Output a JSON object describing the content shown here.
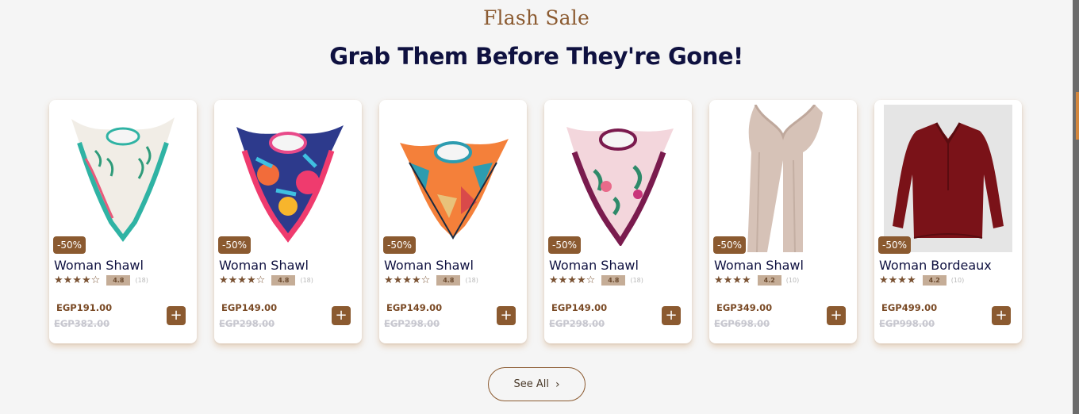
{
  "section": {
    "eyebrow": "Flash Sale",
    "title": "Grab Them Before They're Gone!"
  },
  "colors": {
    "accent": "#8b5a30",
    "title": "#0f1140"
  },
  "products": [
    {
      "name": "Woman Shawl",
      "discount": "-50%",
      "stars": "★★★★☆",
      "rating": "4.8",
      "reviews": "(18)",
      "price": "EGP191.00",
      "old_price": "EGP382.00",
      "add_label": "+",
      "image": "white-teal-scarf"
    },
    {
      "name": "Woman Shawl",
      "discount": "-50%",
      "stars": "★★★★☆",
      "rating": "4.8",
      "reviews": "(18)",
      "price": "EGP149.00",
      "old_price": "EGP298.00",
      "add_label": "+",
      "image": "pink-blue-scarf"
    },
    {
      "name": "Woman Shawl",
      "discount": "-50%",
      "stars": "★★★★☆",
      "rating": "4.8",
      "reviews": "(18)",
      "price": "EGP149.00",
      "old_price": "EGP298.00",
      "add_label": "+",
      "image": "orange-geometric-scarf"
    },
    {
      "name": "Woman Shawl",
      "discount": "-50%",
      "stars": "★★★★☆",
      "rating": "4.8",
      "reviews": "(18)",
      "price": "EGP149.00",
      "old_price": "EGP298.00",
      "add_label": "+",
      "image": "plum-floral-scarf"
    },
    {
      "name": "Woman Shawl",
      "discount": "-50%",
      "stars": "★★★★",
      "rating": "4.2",
      "reviews": "(10)",
      "price": "EGP349.00",
      "old_price": "EGP698.00",
      "add_label": "+",
      "image": "beige-long-scarf"
    },
    {
      "name": "Woman Bordeaux",
      "discount": "-50%",
      "stars": "★★★★",
      "rating": "4.2",
      "reviews": "(10)",
      "price": "EGP499.00",
      "old_price": "EGP998.00",
      "add_label": "+",
      "image": "bordeaux-blouse"
    }
  ],
  "see_all": {
    "label": "See All",
    "icon": "chevron-right-icon"
  }
}
